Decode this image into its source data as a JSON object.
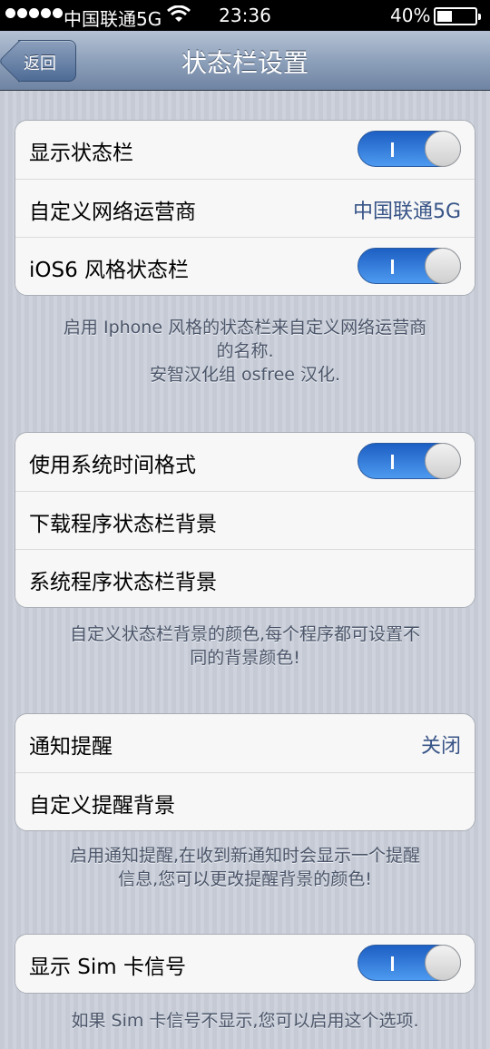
{
  "status_bar": {
    "carrier": "中国联通5G",
    "time": "23:36",
    "battery": "40%",
    "battery_level": 0.4
  },
  "nav": {
    "back_label": "返回",
    "title": "状态栏设置"
  },
  "group1": {
    "row1": {
      "label": "显示状态栏",
      "on": true
    },
    "row2": {
      "label": "自定义网络运营商",
      "value": "中国联通5G"
    },
    "row3": {
      "label": "iOS6 风格状态栏",
      "on": true
    },
    "note_line1": "启用 Iphone 风格的状态栏来自定义网络运营商",
    "note_line2": "的名称.",
    "note_line3": "安智汉化组 osfree 汉化."
  },
  "group2": {
    "row1": {
      "label": "使用系统时间格式",
      "on": true
    },
    "row2": {
      "label": "下载程序状态栏背景"
    },
    "row3": {
      "label": "系统程序状态栏背景"
    },
    "note_line1": "自定义状态栏背景的颜色,每个程序都可设置不",
    "note_line2": "同的背景颜色!"
  },
  "group3": {
    "row1": {
      "label": "通知提醒",
      "value": "关闭"
    },
    "row2": {
      "label": "自定义提醒背景"
    },
    "note_line1": "启用通知提醒,在收到新通知时会显示一个提醒",
    "note_line2": "信息,您可以更改提醒背景的颜色!"
  },
  "group4": {
    "row1": {
      "label": "显示 Sim 卡信号",
      "on": true
    },
    "note_line1": "如果 Sim 卡信号不显示,您可以启用这个选项."
  }
}
